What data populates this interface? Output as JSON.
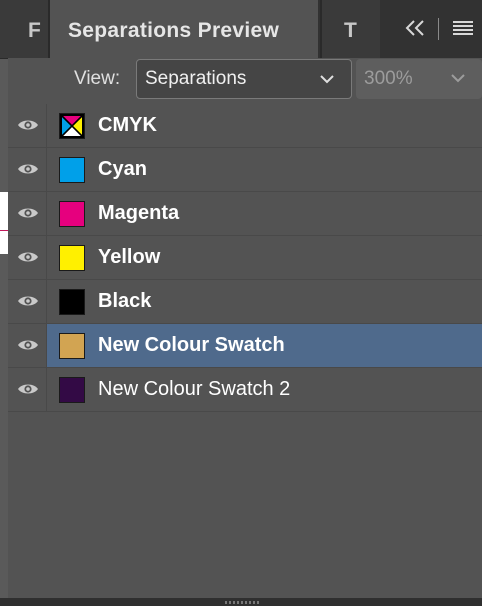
{
  "tabs": [
    {
      "label": "F",
      "active": false
    },
    {
      "label": "Separations Preview",
      "active": true
    },
    {
      "label": "T",
      "active": false
    }
  ],
  "panel_icons": {
    "collapse": "double-chevron-left-icon",
    "menu": "hamburger-menu-icon"
  },
  "view": {
    "label": "View:",
    "selected": "Separations",
    "zoom": "300%"
  },
  "inks": [
    {
      "name": "CMYK",
      "color": "cmyk",
      "visible": true,
      "selected": false,
      "bold": true
    },
    {
      "name": "Cyan",
      "color": "#00a0e9",
      "visible": true,
      "selected": false,
      "bold": true
    },
    {
      "name": "Magenta",
      "color": "#e6007e",
      "visible": true,
      "selected": false,
      "bold": true
    },
    {
      "name": "Yellow",
      "color": "#fff000",
      "visible": true,
      "selected": false,
      "bold": true
    },
    {
      "name": "Black",
      "color": "#000000",
      "visible": true,
      "selected": false,
      "bold": true
    },
    {
      "name": "New Colour Swatch",
      "color": "#d2a452",
      "visible": true,
      "selected": true,
      "bold": true
    },
    {
      "name": "New Colour Swatch 2",
      "color": "#330a45",
      "visible": true,
      "selected": false,
      "bold": false
    }
  ],
  "colors": {
    "panel_bg": "#535353",
    "selection": "#4f6a8c"
  }
}
